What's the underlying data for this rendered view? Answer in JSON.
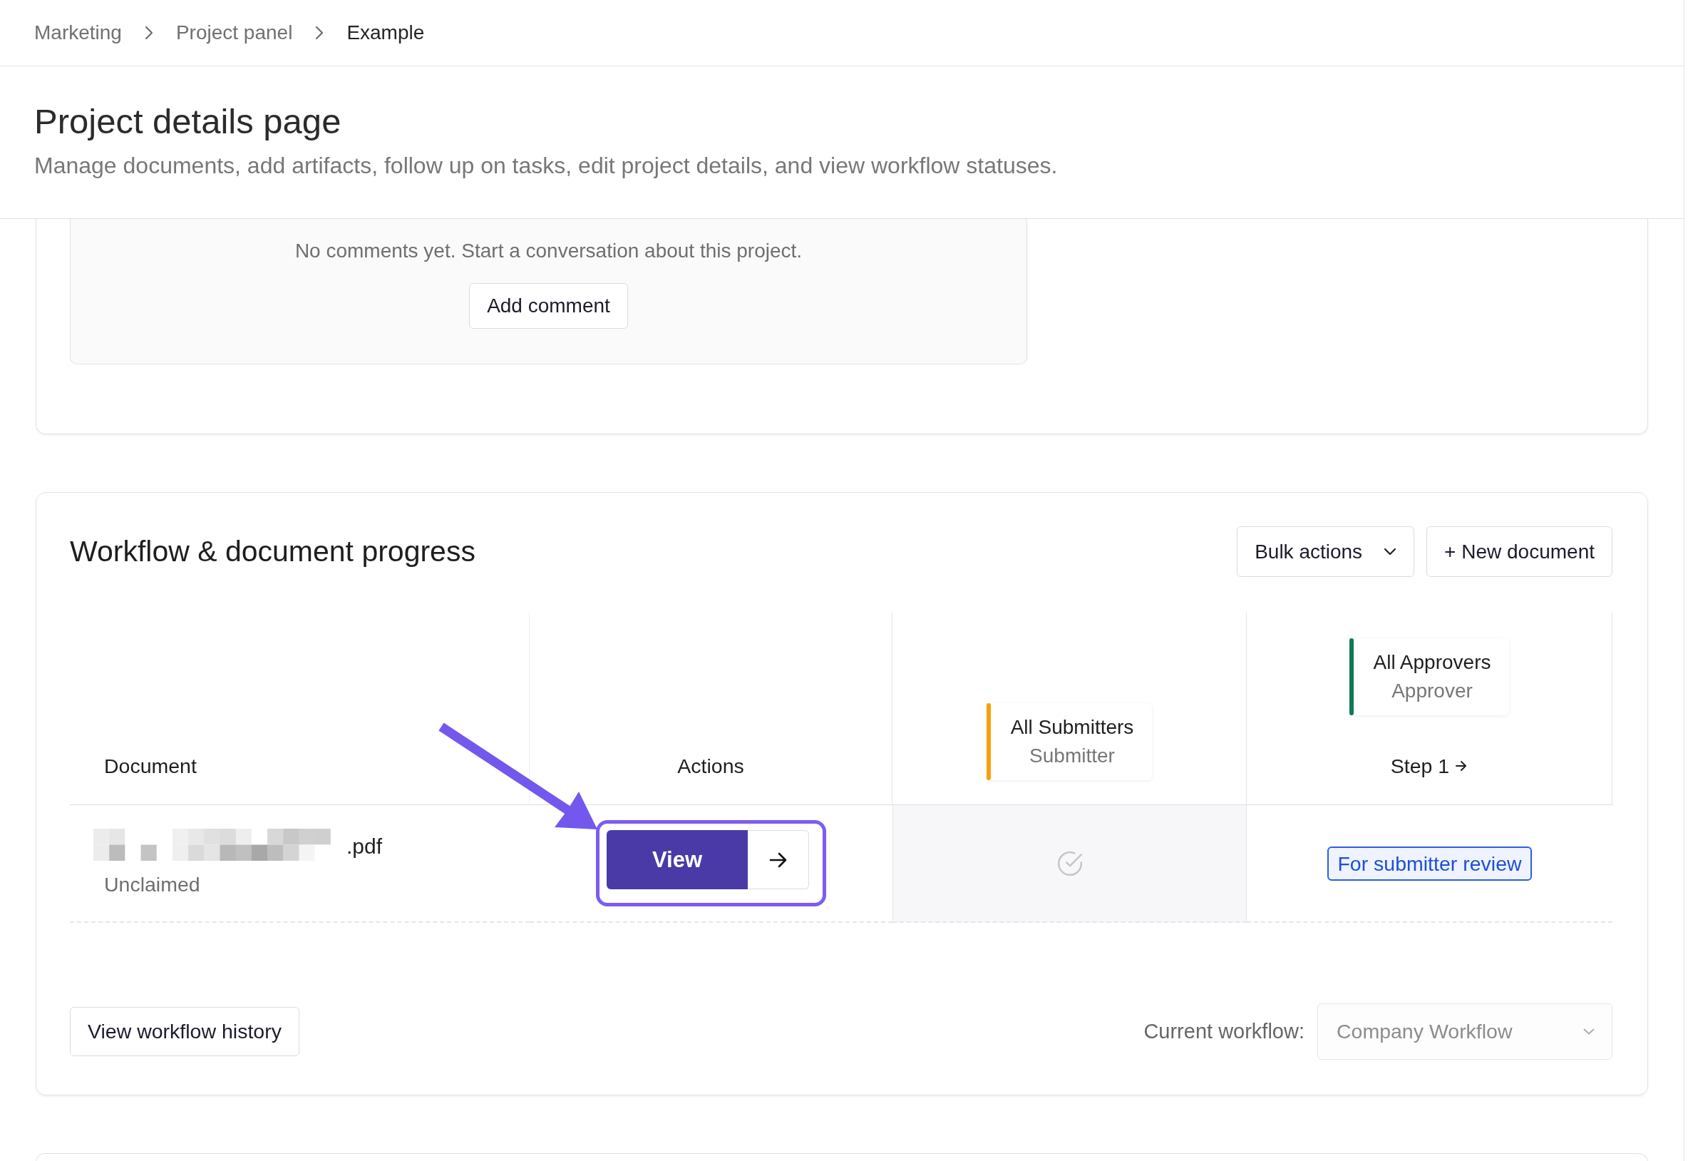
{
  "breadcrumbs": [
    {
      "label": "Marketing",
      "current": false
    },
    {
      "label": "Project panel",
      "current": false
    },
    {
      "label": "Example",
      "current": true
    }
  ],
  "header": {
    "title": "Project details page",
    "description": "Manage documents, add artifacts, follow up on tasks, edit project details, and view workflow statuses."
  },
  "comments": {
    "empty_message": "No comments yet. Start a conversation about this project.",
    "add_button": "Add comment"
  },
  "workflow": {
    "title": "Workflow & document progress",
    "actions": [
      {
        "kind": "dropdown",
        "label": "Bulk actions"
      },
      {
        "kind": "button",
        "label": "+ New document"
      }
    ],
    "columns": [
      {
        "kind": "label",
        "label": "Document"
      },
      {
        "kind": "label",
        "label": "Actions"
      },
      {
        "kind": "group",
        "title": "All Submitters",
        "role": "Submitter",
        "color": "#f5a00f"
      },
      {
        "kind": "step",
        "title": "All Approvers",
        "role": "Approver",
        "color": "#0e7a57",
        "step": "Step 1"
      }
    ],
    "rows": [
      {
        "document": {
          "name": ".pdf",
          "status": "Unclaimed"
        },
        "action": "View",
        "status_badge": "For submitter review"
      }
    ],
    "history_button": "View workflow history",
    "current_workflow": {
      "label": "Current workflow:",
      "value": "Company Workflow",
      "disabled": true
    }
  }
}
